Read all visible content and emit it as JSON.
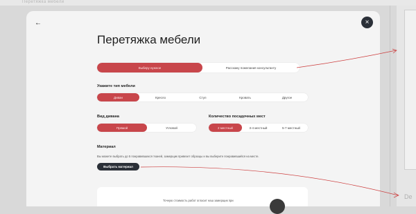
{
  "background": {
    "top_text": "Перетяжка мебели",
    "right_text": "De"
  },
  "modal": {
    "title": "Перетяжка мебели",
    "mode": {
      "options": [
        "Выберу нужное",
        "Расскажу пожелания консультанту"
      ],
      "selected": 0
    },
    "furniture_type": {
      "label": "Укажите тип мебели",
      "options": [
        "Диван",
        "Кресло",
        "Стул",
        "Кровать",
        "Другое"
      ],
      "selected": 0
    },
    "sofa_type": {
      "label": "Вид дивана",
      "options": [
        "Прямой",
        "Угловой"
      ],
      "selected": 0
    },
    "seats": {
      "label": "Количество посадочных мест",
      "options": [
        "2 местный",
        "3-4 местный",
        "5-7 местный"
      ],
      "selected": 0
    },
    "material": {
      "label": "Материал",
      "helper": "Вы можете выбрать до 5 понравившихся тканей, замерщик привезет образцы и вы выберите понравившийся на месте.",
      "button": "Выбрать материал"
    },
    "bottom_note": "Точную стоимость работ огласит наш замерщик при"
  },
  "colors": {
    "accent": "#c8464b",
    "dark_button": "#2b3038",
    "annotation_line": "#cc3b3b"
  }
}
